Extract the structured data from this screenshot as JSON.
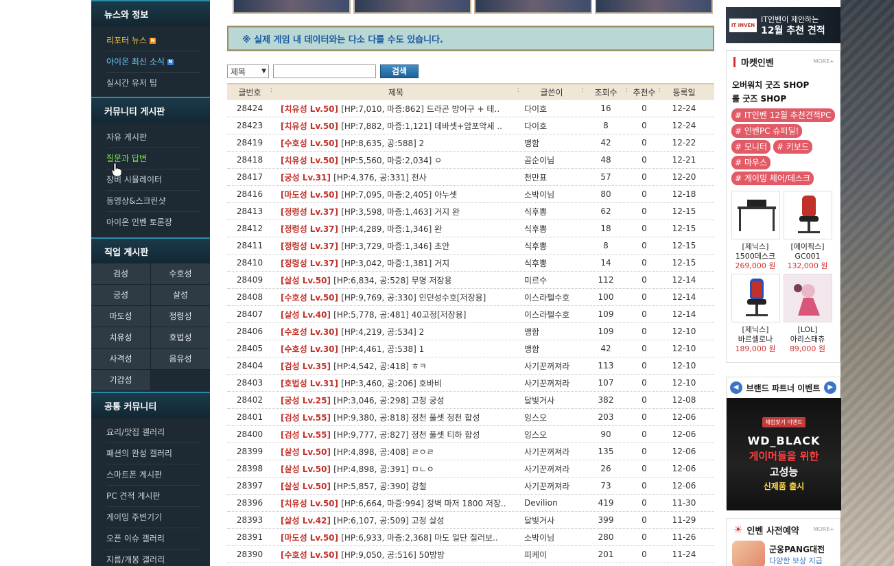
{
  "sidebar": {
    "sections": [
      {
        "title": "뉴스와 정보",
        "items": [
          {
            "label": "리포터 뉴스",
            "badge": "N",
            "style": "yellow"
          },
          {
            "label": "아이온 최신 소식",
            "badge": "N",
            "style": "blue"
          },
          {
            "label": "실시간 유저 팁",
            "style": ""
          }
        ]
      },
      {
        "title": "커뮤니티 게시판",
        "items": [
          {
            "label": "자유 게시판",
            "style": ""
          },
          {
            "label": "질문과 답변",
            "style": "green"
          },
          {
            "label": "장비 시뮬레이터",
            "style": ""
          },
          {
            "label": "동영상&스크린샷",
            "style": ""
          },
          {
            "label": "아이온 인벤 토론장",
            "style": ""
          }
        ]
      },
      {
        "title": "직업 게시판",
        "jobs": [
          "검성",
          "수호성",
          "궁성",
          "살성",
          "마도성",
          "정령성",
          "치유성",
          "호법성",
          "사격성",
          "음유성",
          "기갑성"
        ]
      },
      {
        "title": "공통 커뮤니티",
        "items": [
          {
            "label": "요리/맛집 갤러리",
            "style": ""
          },
          {
            "label": "패션의 완성 갤러리",
            "style": ""
          },
          {
            "label": "스마트폰 게시판",
            "style": ""
          },
          {
            "label": "PC 견적 게시판",
            "style": ""
          },
          {
            "label": "게이밍 주변기기",
            "style": ""
          },
          {
            "label": "오픈 이슈 갤러리",
            "style": ""
          },
          {
            "label": "지름/개봉 갤러리",
            "style": ""
          }
        ]
      }
    ]
  },
  "notice": "※ 실제 게임 내 데이터와는 다소 다를 수도 있습니다.",
  "search": {
    "select_value": "제목",
    "button_label": "검색"
  },
  "board": {
    "headers": [
      "글번호",
      "제목",
      "글쓴이",
      "조회수",
      "추천수",
      "등록일"
    ],
    "rows": [
      {
        "no": "28424",
        "cls": "[치유성 Lv.50]",
        "stat": "[HP:7,010, 마증:862] 드라곤 방어구 + 테..",
        "author": "다이호",
        "views": "16",
        "rec": "0",
        "date": "12-24"
      },
      {
        "no": "28423",
        "cls": "[치유성 Lv.50]",
        "stat": "[HP:7,882, 마증:1,121] 데바셋+암포악세 ..",
        "author": "다이호",
        "views": "8",
        "rec": "0",
        "date": "12-24"
      },
      {
        "no": "28419",
        "cls": "[수호성 Lv.50]",
        "stat": "[HP:8,635, 공:588] 2",
        "author": "맹함",
        "views": "42",
        "rec": "0",
        "date": "12-22"
      },
      {
        "no": "28418",
        "cls": "[치유성 Lv.50]",
        "stat": "[HP:5,560, 마증:2,034] ㅇ",
        "author": "곰순이님",
        "views": "48",
        "rec": "0",
        "date": "12-21"
      },
      {
        "no": "28417",
        "cls": "[궁성 Lv.31]",
        "stat": "[HP:4,376, 공:331] 천사",
        "author": "천만표",
        "views": "57",
        "rec": "0",
        "date": "12-20"
      },
      {
        "no": "28416",
        "cls": "[마도성 Lv.50]",
        "stat": "[HP:7,095, 마증:2,405] 아누셋",
        "author": "소박이님",
        "views": "80",
        "rec": "0",
        "date": "12-18"
      },
      {
        "no": "28413",
        "cls": "[정령성 Lv.37]",
        "stat": "[HP:3,598, 마증:1,463] 거지 완",
        "author": "식후뽕",
        "views": "62",
        "rec": "0",
        "date": "12-15"
      },
      {
        "no": "28412",
        "cls": "[정령성 Lv.37]",
        "stat": "[HP:4,289, 마증:1,346] 완",
        "author": "식후뽕",
        "views": "18",
        "rec": "0",
        "date": "12-15"
      },
      {
        "no": "28411",
        "cls": "[정령성 Lv.37]",
        "stat": "[HP:3,729, 마증:1,346] 초안",
        "author": "식후뽕",
        "views": "8",
        "rec": "0",
        "date": "12-15"
      },
      {
        "no": "28410",
        "cls": "[정령성 Lv.37]",
        "stat": "[HP:3,042, 마증:1,381] 거지",
        "author": "식후뽕",
        "views": "14",
        "rec": "0",
        "date": "12-15"
      },
      {
        "no": "28409",
        "cls": "[살성 Lv.50]",
        "stat": "[HP:6,834, 공:528] 무명 저장용",
        "author": "미르수",
        "views": "112",
        "rec": "0",
        "date": "12-14"
      },
      {
        "no": "28408",
        "cls": "[수호성 Lv.50]",
        "stat": "[HP:9,769, 공:330] 인던성수호[저장용]",
        "author": "이스라펠수호",
        "views": "100",
        "rec": "0",
        "date": "12-14"
      },
      {
        "no": "28407",
        "cls": "[살성 Lv.40]",
        "stat": "[HP:5,778, 공:481] 40고정[저장용]",
        "author": "이스라펠수호",
        "views": "109",
        "rec": "0",
        "date": "12-14"
      },
      {
        "no": "28406",
        "cls": "[수호성 Lv.30]",
        "stat": "[HP:4,219, 공:534] 2",
        "author": "맹함",
        "views": "109",
        "rec": "0",
        "date": "12-10"
      },
      {
        "no": "28405",
        "cls": "[수호성 Lv.30]",
        "stat": "[HP:4,461, 공:538] 1",
        "author": "맹함",
        "views": "42",
        "rec": "0",
        "date": "12-10"
      },
      {
        "no": "28404",
        "cls": "[검성 Lv.35]",
        "stat": "[HP:4,542, 공:418] ㅎㅋ",
        "author": "사기꾼꺼져라",
        "views": "113",
        "rec": "0",
        "date": "12-10"
      },
      {
        "no": "28403",
        "cls": "[호법성 Lv.31]",
        "stat": "[HP:3,460, 공:206] 호바비",
        "author": "사기꾼꺼져라",
        "views": "107",
        "rec": "0",
        "date": "12-10"
      },
      {
        "no": "28402",
        "cls": "[궁성 Lv.25]",
        "stat": "[HP:3,046, 공:298] 고정 궁성",
        "author": "달빛거사",
        "views": "382",
        "rec": "0",
        "date": "12-08"
      },
      {
        "no": "28401",
        "cls": "[검성 Lv.55]",
        "stat": "[HP:9,380, 공:818] 정천 풀셋 정천 합성",
        "author": "잉스오",
        "views": "203",
        "rec": "0",
        "date": "12-06"
      },
      {
        "no": "28400",
        "cls": "[검성 Lv.55]",
        "stat": "[HP:9,777, 공:827] 정천 풀셋 티하 합성",
        "author": "잉스오",
        "views": "90",
        "rec": "0",
        "date": "12-06"
      },
      {
        "no": "28399",
        "cls": "[살성 Lv.50]",
        "stat": "[HP:4,898, 공:408] ㄹㅇㄹ",
        "author": "사기꾼꺼져라",
        "views": "135",
        "rec": "0",
        "date": "12-06"
      },
      {
        "no": "28398",
        "cls": "[살성 Lv.50]",
        "stat": "[HP:4,898, 공:391] ㅁㄴㅇ",
        "author": "사기꾼꺼져라",
        "views": "26",
        "rec": "0",
        "date": "12-06"
      },
      {
        "no": "28397",
        "cls": "[살성 Lv.50]",
        "stat": "[HP:5,857, 공:390] 강철",
        "author": "사기꾼꺼져라",
        "views": "73",
        "rec": "0",
        "date": "12-06"
      },
      {
        "no": "28396",
        "cls": "[치유성 Lv.50]",
        "stat": "[HP:6,664, 마증:994] 정벽 마저 1800 저장..",
        "author": "Devilion",
        "views": "419",
        "rec": "0",
        "date": "11-30"
      },
      {
        "no": "28393",
        "cls": "[살성 Lv.42]",
        "stat": "[HP:6,107, 공:509] 고정 살성",
        "author": "달빛거사",
        "views": "399",
        "rec": "0",
        "date": "11-29"
      },
      {
        "no": "28391",
        "cls": "[마도성 Lv.50]",
        "stat": "[HP:6,933, 마증:2,368] 마도 일단 질러보..",
        "author": "소박이님",
        "views": "280",
        "rec": "0",
        "date": "11-26"
      },
      {
        "no": "28390",
        "cls": "[수호성 Lv.50]",
        "stat": "[HP:9,050, 공:516] 50방방",
        "author": "피케이",
        "views": "201",
        "rec": "0",
        "date": "11-24"
      }
    ]
  },
  "right": {
    "ad_top": {
      "logo": "IT INVEN",
      "line1": "IT인벤이 제안하는",
      "line2": "12월 추천 견적"
    },
    "market": {
      "title": "마켓인벤",
      "more": "MORE+",
      "shops": [
        "오버워치 굿즈 SHOP",
        "롤 굿즈 SHOP"
      ],
      "tags": [
        "# IT인벤 12월 추천견적PC",
        "# 인벤PC 슈퍼딜!",
        "# 모니터",
        "# 키보드",
        "# 마우스",
        "# 게이밍 체어/데스크"
      ],
      "goods": [
        {
          "name1": "[제닉스]",
          "name2": "1500데스크",
          "price": "269,000 원"
        },
        {
          "name1": "[에이픽스]",
          "name2": "GC001",
          "price": "132,000 원"
        },
        {
          "name1": "[제닉스]",
          "name2": "바르셀로나",
          "price": "189,000 원"
        },
        {
          "name1": "[LOL]",
          "name2": "아리스태츄",
          "price": "89,000 원"
        }
      ]
    },
    "brand": {
      "title": "브랜드 파트너 이벤트",
      "small": "체험찾기 이벤트",
      "wd": "WD_BLACK",
      "gamer": "게이머들을 위한",
      "perf": "고성능",
      "newp": "신제품 출시"
    },
    "reserve": {
      "title": "인벤 사전예약",
      "more": "MORE+",
      "game": "군웅PANG대전",
      "sub": "다양한 보상 지급"
    }
  }
}
